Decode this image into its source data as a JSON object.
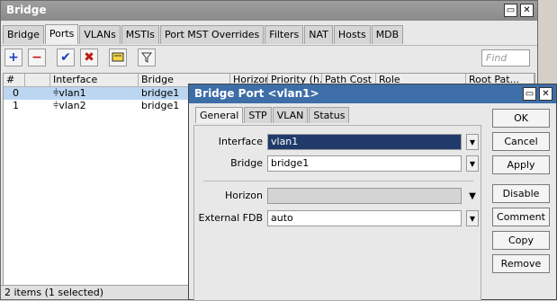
{
  "window": {
    "title": "Bridge"
  },
  "tabs": [
    "Bridge",
    "Ports",
    "VLANs",
    "MSTIs",
    "Port MST Overrides",
    "Filters",
    "NAT",
    "Hosts",
    "MDB"
  ],
  "active_tab": "Ports",
  "find_placeholder": "Find",
  "table": {
    "columns": [
      "#",
      "",
      "Interface",
      "Bridge",
      "Horizon",
      "Priority (h...",
      "Path Cost",
      "Role",
      "Root Pat..."
    ],
    "rows": [
      {
        "num": "0",
        "interface": "vlan1",
        "bridge": "bridge1"
      },
      {
        "num": "1",
        "interface": "vlan2",
        "bridge": "bridge1"
      }
    ]
  },
  "status_bar": "2 items (1 selected)",
  "dialog": {
    "title": "Bridge Port <vlan1>",
    "tabs": [
      "General",
      "STP",
      "VLAN",
      "Status"
    ],
    "fields": {
      "interface_label": "Interface",
      "interface_value": "vlan1",
      "bridge_label": "Bridge",
      "bridge_value": "bridge1",
      "horizon_label": "Horizon",
      "horizon_value": "",
      "external_fdb_label": "External FDB",
      "external_fdb_value": "auto"
    },
    "buttons": [
      "OK",
      "Cancel",
      "Apply",
      "Disable",
      "Comment",
      "Copy",
      "Remove"
    ]
  },
  "colors": {
    "dialog_titlebar": "#3d6ea8",
    "selected_row": "#bcd6f2",
    "highlighted_field": "#203a6a"
  }
}
